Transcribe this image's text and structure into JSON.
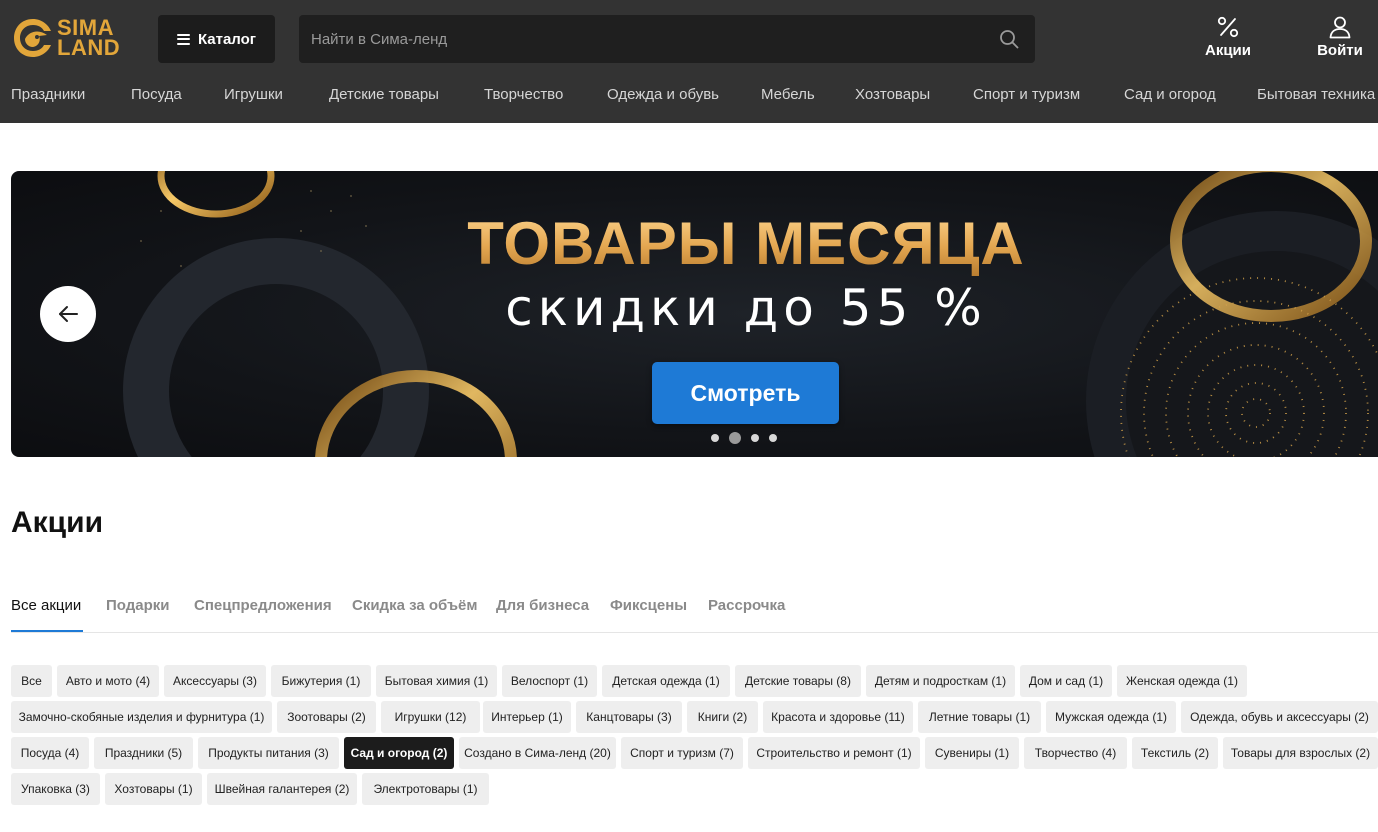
{
  "header": {
    "logo_top": "SIMA",
    "logo_bottom": "LAND",
    "brand_color": "#e2a63a",
    "catalog_label": "Каталог",
    "search_placeholder": "Найти в Сима-ленд",
    "promo_label": "Акции",
    "login_label": "Войти"
  },
  "nav": [
    "Праздники",
    "Посуда",
    "Игрушки",
    "Детские товары",
    "Творчество",
    "Одежда и обувь",
    "Мебель",
    "Хозтовары",
    "Спорт и туризм",
    "Сад и огород",
    "Бытовая техника"
  ],
  "banner": {
    "title": "ТОВАРЫ МЕСЯЦА",
    "subtitle": "скидки до 55 %",
    "button_label": "Смотреть",
    "button_color": "#1e7ad6",
    "slides_count": 4,
    "active_slide": 2
  },
  "page": {
    "title": "Акции"
  },
  "tabs": [
    "Все акции",
    "Подарки",
    "Спецпредложения",
    "Скидка за объём",
    "Для бизнеса",
    "Фиксцены",
    "Рассрочка"
  ],
  "active_tab": "Все акции",
  "chips": [
    [
      "Все",
      "Авто и мото (4)",
      "Аксессуары (3)",
      "Бижутерия (1)",
      "Бытовая химия (1)",
      "Велоспорт (1)",
      "Детская одежда (1)",
      "Детские товары (8)",
      "Детям и подросткам (1)",
      "Дом и сад (1)",
      "Женская одежда (1)"
    ],
    [
      "Замочно-скобяные изделия и фурнитура (1)",
      "Зоотовары (2)",
      "Игрушки (12)",
      "Интерьер (1)",
      "Канцтовары (3)",
      "Книги (2)",
      "Красота и здоровье (11)",
      "Летние товары (1)",
      "Мужская одежда (1)",
      "Одежда, обувь и аксессуары (2)"
    ],
    [
      "Посуда (4)",
      "Праздники (5)",
      "Продукты питания (3)",
      "Сад и огород (2)",
      "Создано в Сима-ленд (20)",
      "Спорт и туризм (7)",
      "Строительство и ремонт (1)",
      "Сувениры (1)",
      "Творчество (4)",
      "Текстиль (2)",
      "Товары для взрослых (2)"
    ],
    [
      "Упаковка (3)",
      "Хозтовары (1)",
      "Швейная галантерея (2)",
      "Электротовары (1)"
    ]
  ],
  "active_chip": "Сад и огород (2)"
}
